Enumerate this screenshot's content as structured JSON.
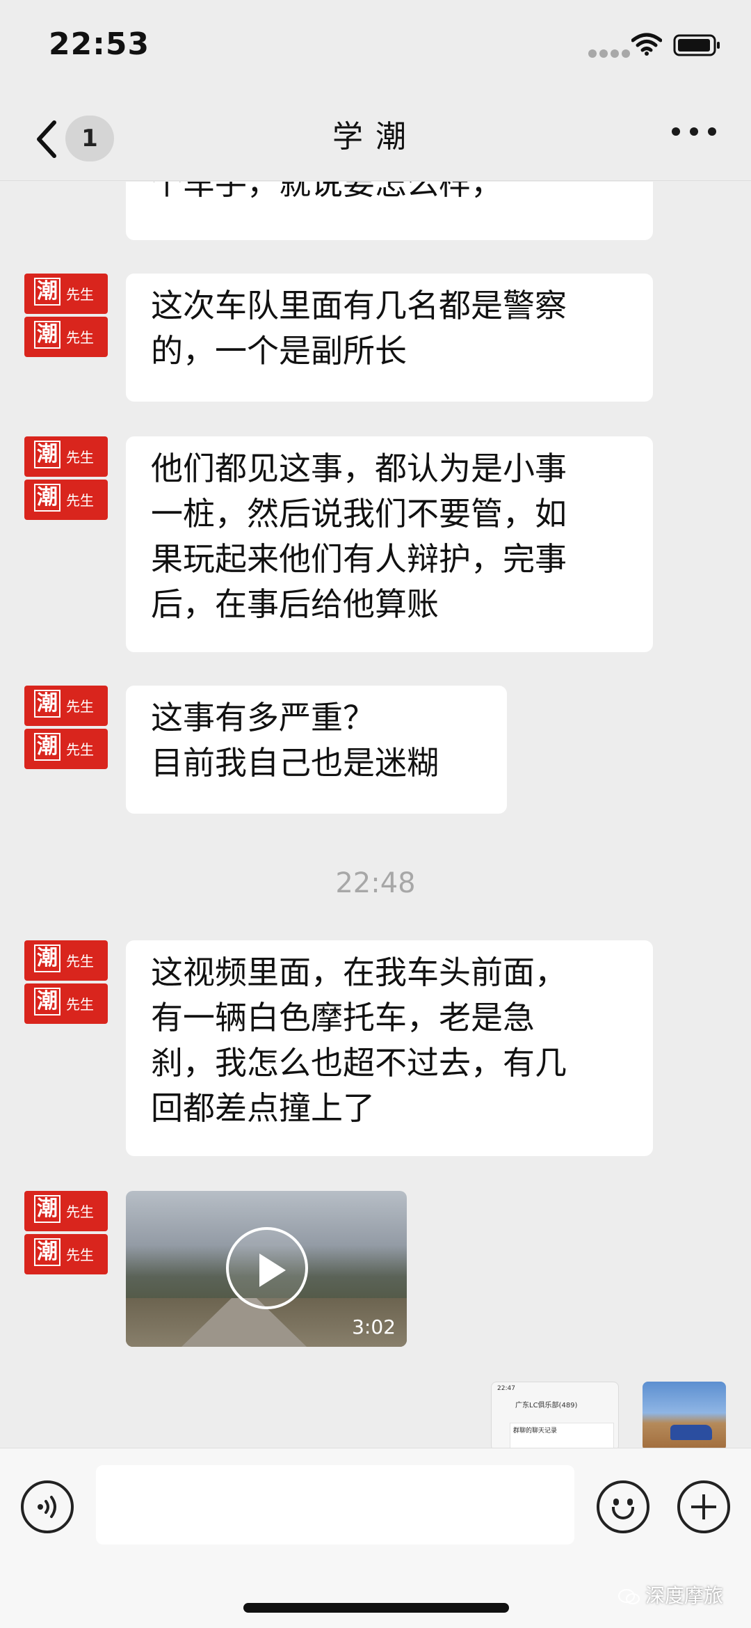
{
  "status_bar": {
    "time": "22:53"
  },
  "header": {
    "unread_count": "1",
    "title": "学潮"
  },
  "avatar": {
    "char": "潮",
    "sub": "先生"
  },
  "messages": [
    {
      "lines": [
        "个车手，就说要怎么样，"
      ]
    },
    {
      "lines": [
        "这次车队里面有几名都是警察",
        "的，一个是副所长"
      ]
    },
    {
      "lines": [
        "他们都见这事，都认为是小事",
        "一桩，然后说我们不要管，如",
        "果玩起来他们有人辩护，完事",
        "后，在事后给他算账"
      ]
    },
    {
      "lines": [
        "这事有多严重？",
        "目前我自己也是迷糊"
      ]
    },
    {
      "lines": [
        "这视频里面，在我车头前面，",
        "有一辆白色摩托车，老是急",
        "刹，我怎么也超不过去，有几",
        "回都差点撞上了"
      ]
    }
  ],
  "time_divider": "22:48",
  "video": {
    "duration": "3:02"
  },
  "shared_screenshot": {
    "time": "22:47",
    "title": "广东LC俱乐部(489)",
    "card_title": "群聊的聊天记录"
  },
  "watermark": "深度摩旅",
  "colors": {
    "avatar_red": "#d9251d",
    "background": "#ededed",
    "bubble": "#ffffff"
  }
}
